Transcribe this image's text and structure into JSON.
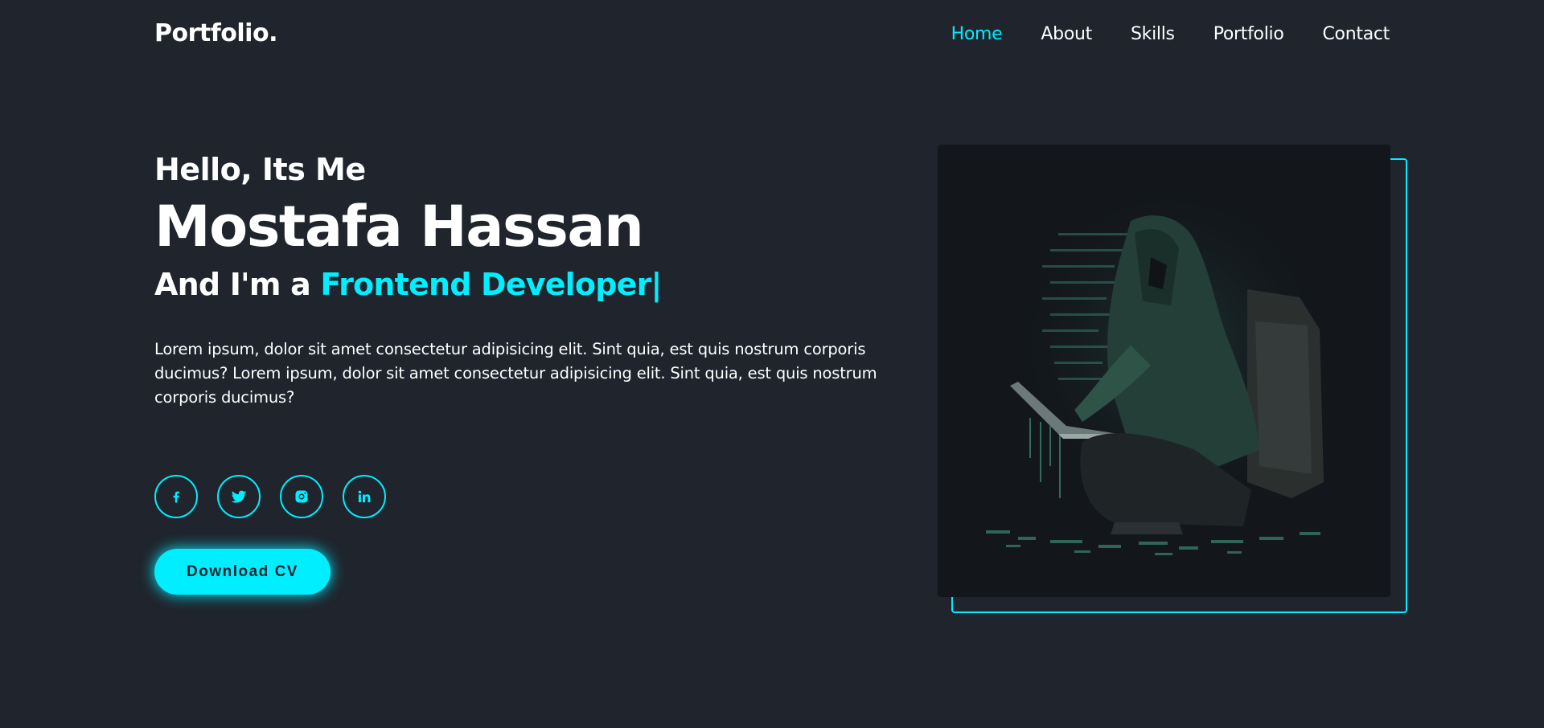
{
  "header": {
    "logo": "Portfolio.",
    "nav": [
      {
        "label": "Home",
        "active": true
      },
      {
        "label": "About",
        "active": false
      },
      {
        "label": "Skills",
        "active": false
      },
      {
        "label": "Portfolio",
        "active": false
      },
      {
        "label": "Contact",
        "active": false
      }
    ]
  },
  "hero": {
    "greeting": "Hello, Its Me",
    "name": "Mostafa Hassan",
    "role_prefix": "And I'm a ",
    "role_highlight": "Frontend Developer",
    "cursor": "|",
    "description": "Lorem ipsum, dolor sit amet consectetur adipisicing elit. Sint quia, est quis nostrum corporis ducimus? Lorem ipsum, dolor sit amet consectetur adipisicing elit. Sint quia, est quis nostrum corporis ducimus?",
    "cv_button": "Download CV"
  },
  "social": [
    {
      "icon": "facebook-icon"
    },
    {
      "icon": "twitter-icon"
    },
    {
      "icon": "instagram-icon"
    },
    {
      "icon": "linkedin-icon"
    }
  ],
  "image": {
    "subject": "hooded-hacker-illustration"
  },
  "colors": {
    "background": "#1f242d",
    "accent": "#00eeff",
    "text": "#ffffff"
  }
}
